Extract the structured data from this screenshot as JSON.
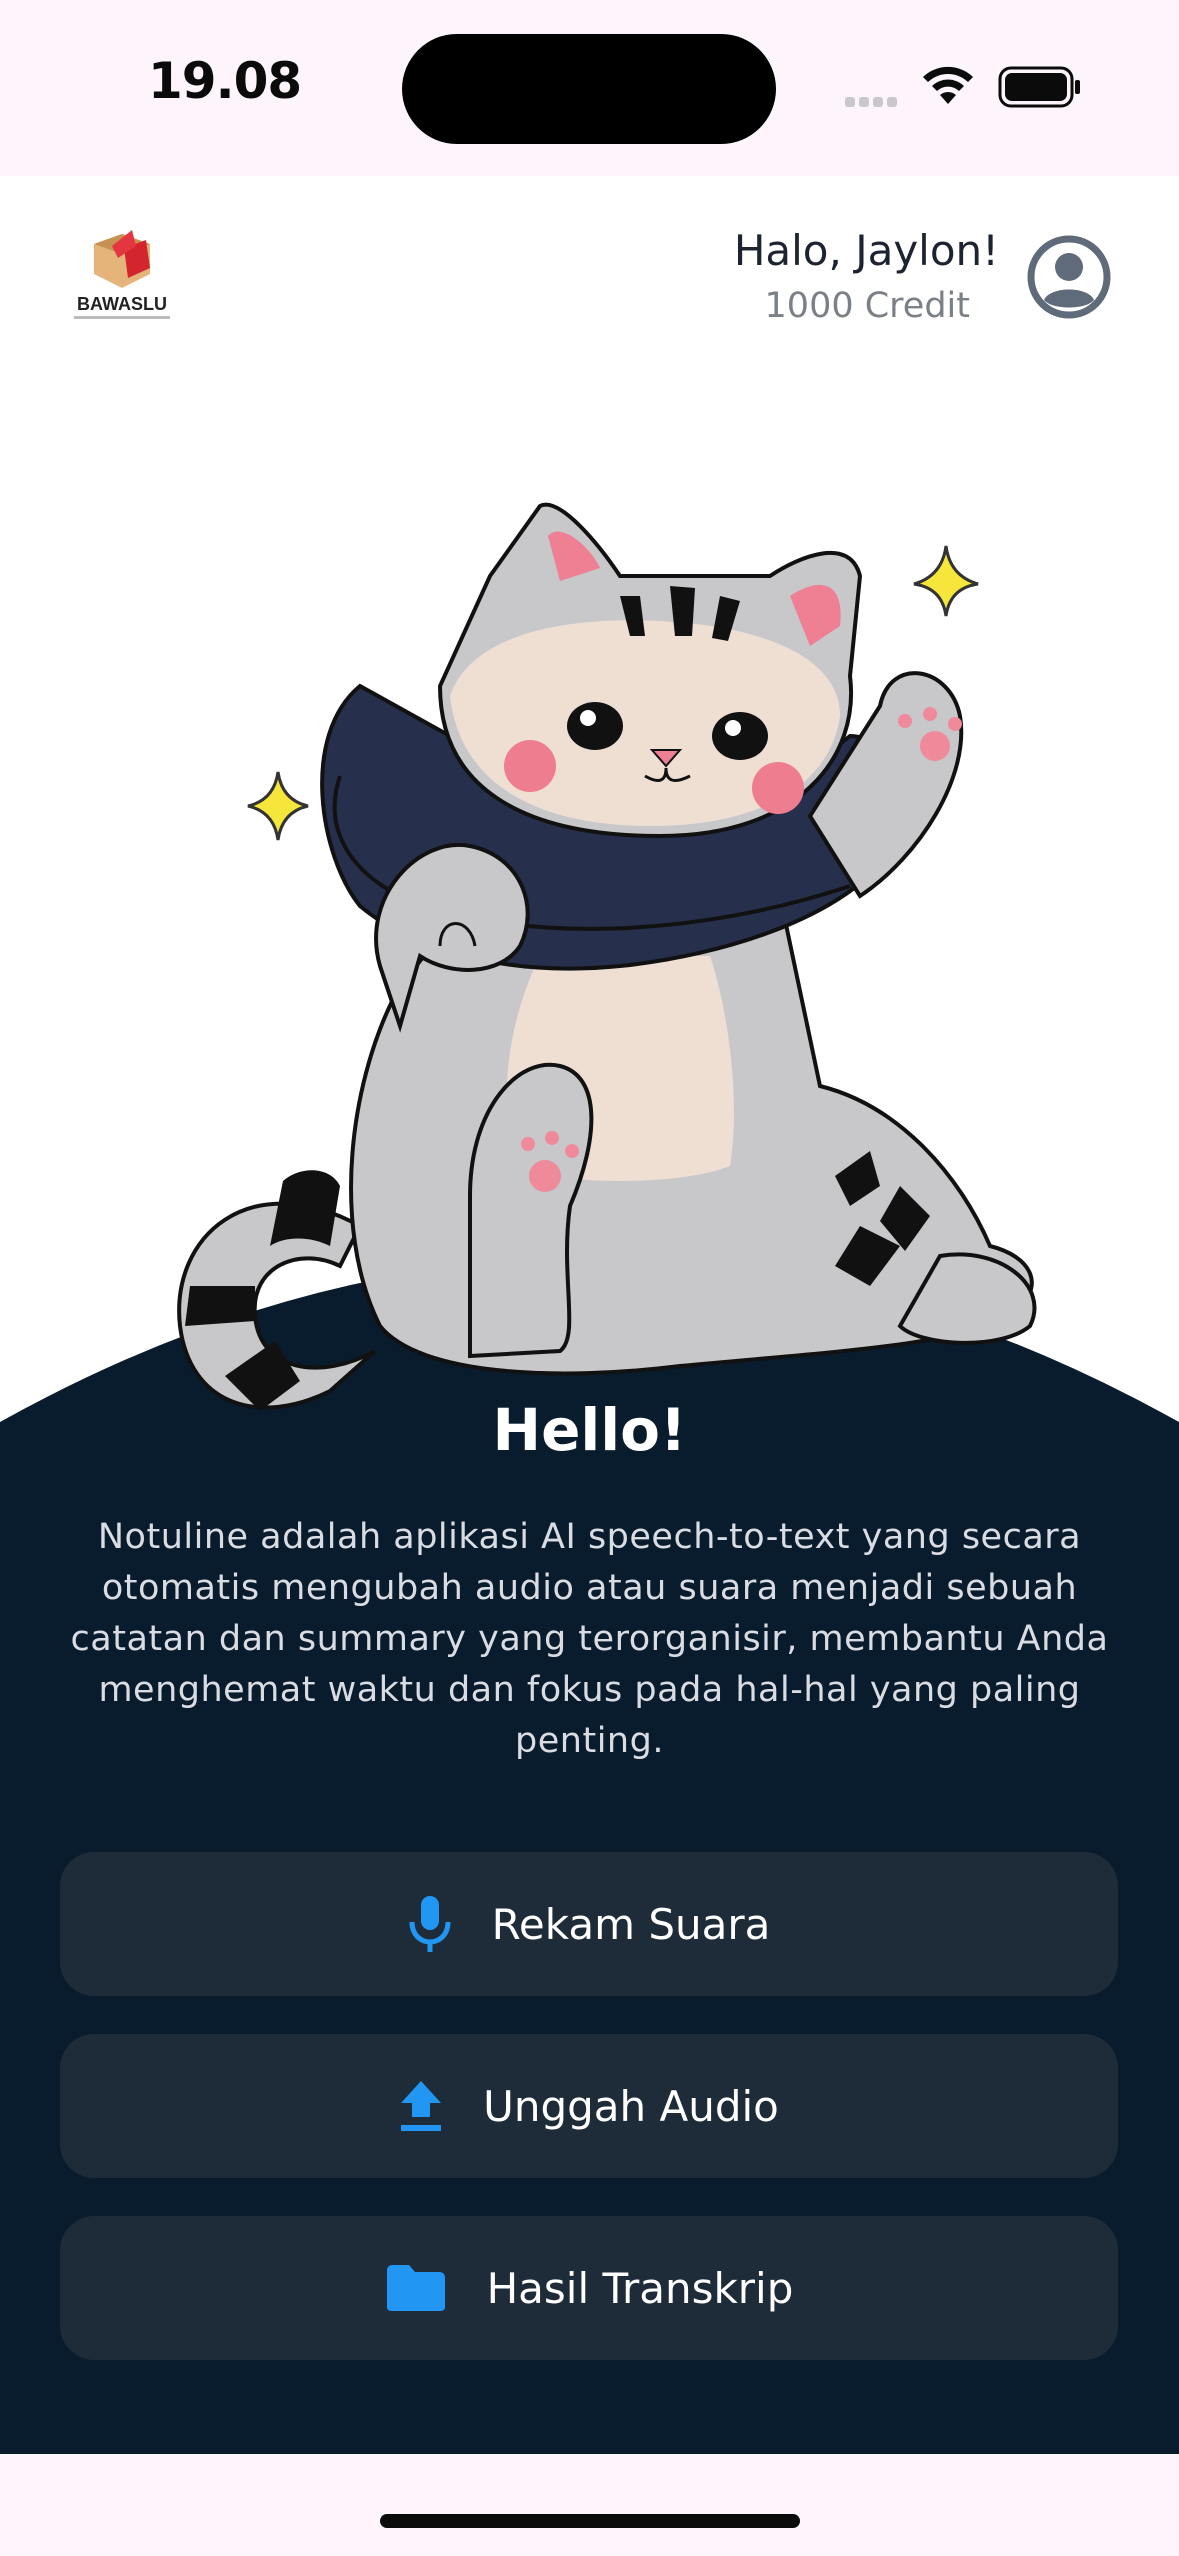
{
  "status_bar": {
    "time": "19.08",
    "icons": [
      "cellular-signal-icon",
      "wifi-icon",
      "battery-icon"
    ]
  },
  "header": {
    "logo_text": "BAWASLU",
    "greeting": "Halo, Jaylon!",
    "credit": "1000 Credit",
    "profile_icon": "account-circle-icon"
  },
  "hero": {
    "illustration": "waving-tabby-cat-icon",
    "title": "Hello!",
    "description": "Notuline adalah aplikasi AI speech-to-text yang secara otomatis mengubah audio atau suara menjadi sebuah catatan dan summary yang terorganisir, membantu Anda menghemat waktu dan fokus pada hal-hal yang paling penting."
  },
  "actions": [
    {
      "label": "Rekam Suara",
      "icon": "microphone-icon"
    },
    {
      "label": "Unggah Audio",
      "icon": "upload-icon"
    },
    {
      "label": "Hasil Transkrip",
      "icon": "folder-icon"
    }
  ],
  "colors": {
    "panel": "#081c2e",
    "button": "#1e2b39",
    "accent": "#2196f3",
    "background": "#ffffff"
  }
}
